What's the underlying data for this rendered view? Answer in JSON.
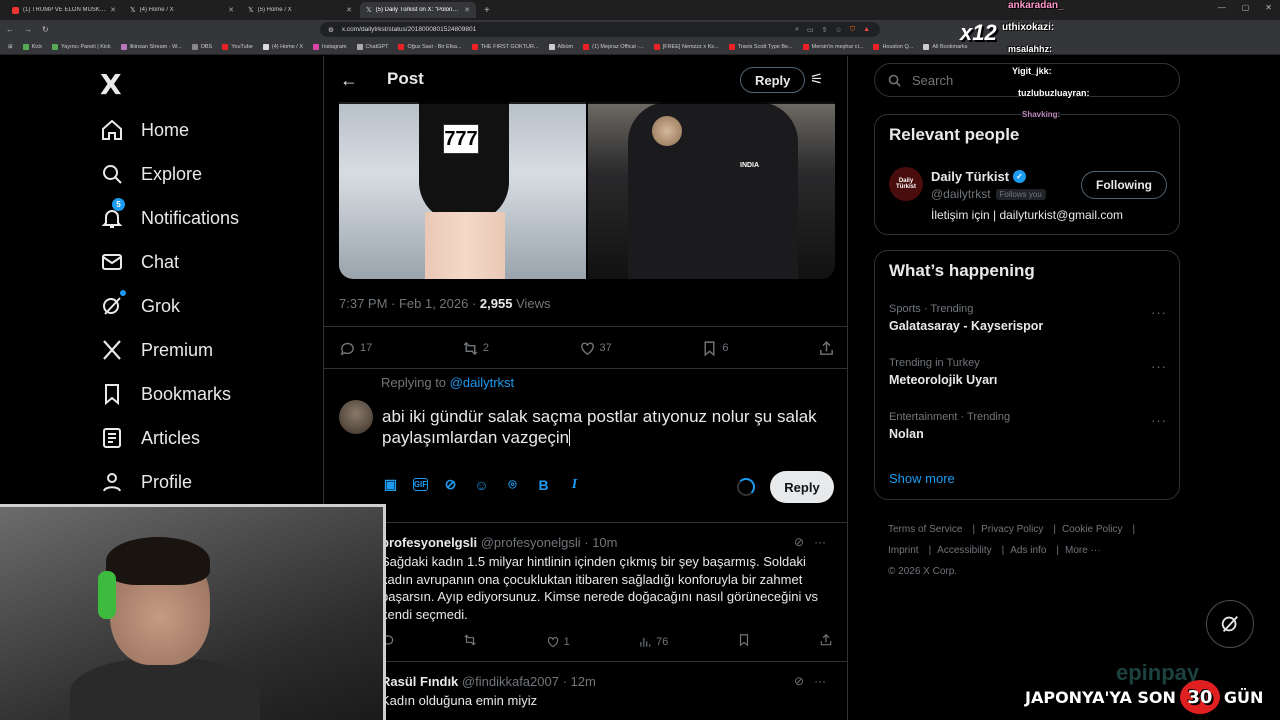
{
  "browser": {
    "tabs": [
      {
        "title": "(1) TRUMP VE ELON MUSK İFŞA OLD",
        "active": false
      },
      {
        "title": "(4) Home / X",
        "active": false
      },
      {
        "title": "(5) Home / X",
        "active": false
      },
      {
        "title": "(5) Daily Türkist on X: \"Polonya'lı",
        "active": true
      }
    ],
    "url": "x.com/dailytrkst/status/2018000801524809801",
    "bookmarks": [
      "Kick",
      "Yayıncı Paneli | Kick",
      "ilkinsan Stream - W...",
      "OBS",
      "YouTube",
      "(4) Home / X",
      "Instagram",
      "ChatGPT",
      "Oğuz Sasi - Bir Efsa...",
      "THE FIRST GOKTUR...",
      "Albüm",
      "(1) Mepraz Offical -...",
      "[FREE] Nemzzz x Ks...",
      "Travis Scott Type Be...",
      "Mersin'in meşhur ci...",
      "Houston Q...",
      "All Bookmarks"
    ]
  },
  "nav": {
    "logo": "X",
    "items": [
      {
        "label": "Home",
        "icon": "home-icon"
      },
      {
        "label": "Explore",
        "icon": "search-icon"
      },
      {
        "label": "Notifications",
        "icon": "bell-icon",
        "badge": "5"
      },
      {
        "label": "Chat",
        "icon": "mail-icon"
      },
      {
        "label": "Grok",
        "icon": "grok-icon"
      },
      {
        "label": "Premium",
        "icon": "x-premium-icon"
      },
      {
        "label": "Bookmarks",
        "icon": "bookmark-icon"
      },
      {
        "label": "Articles",
        "icon": "article-icon"
      },
      {
        "label": "Profile",
        "icon": "person-icon"
      }
    ]
  },
  "post": {
    "header_title": "Post",
    "header_reply": "Reply",
    "bib_number": "777",
    "right_image_text": "INDIA",
    "time": "7:37 PM · Feb 1, 2026 · ",
    "views_count": "2,955",
    "views_label": " Views",
    "actions": {
      "replies": "17",
      "reposts": "2",
      "likes": "37",
      "bookmarks": "6"
    }
  },
  "compose": {
    "replying_prefix": "Replying to ",
    "replying_handle": "@dailytrkst",
    "text": "abi iki gündür salak saçma postlar atıyonuz nolur şu salak paylaşımlardan vazgeçin",
    "reply_button": "Reply"
  },
  "replies": [
    {
      "name": "profesyonelgsli",
      "handle": "@profesyonelgsli",
      "time": "· 10m",
      "text": "Sağdaki kadın 1.5 milyar hintlinin içinden çıkmış bir şey başarmış. Soldaki kadın avrupanın ona çocukluktan itibaren sağladığı konforuyla bir zahmet başarsın. Ayıp ediyorsunuz. Kimse nerede doğacağını nasıl görüneceğini vs kendi seçmedi.",
      "likes": "1",
      "views": "76"
    },
    {
      "name": "Rasül Fındık",
      "handle": "@findikkafa2007",
      "time": "· 12m",
      "text": "Kadın olduğuna emin miyiz"
    }
  ],
  "sidebar": {
    "search_placeholder": "Search",
    "relevant_title": "Relevant people",
    "person": {
      "avatar_text": "Daily Türkist",
      "name": "Daily Türkist",
      "handle": "@dailytrkst",
      "follows_you": "Follows you",
      "bio": "İletişim için | dailyturkist@gmail.com",
      "button": "Following"
    },
    "happening_title": "What’s happening",
    "trends": [
      {
        "category": "Sports · Trending",
        "name": "Galatasaray - Kayserispor"
      },
      {
        "category": "Trending in Turkey",
        "name": "Meteorolojik Uyarı"
      },
      {
        "category": "Entertainment · Trending",
        "name": "Nolan"
      }
    ],
    "show_more": "Show more",
    "footer": [
      "Terms of Service",
      "Privacy Policy",
      "Cookie Policy",
      "Imprint",
      "Accessibility",
      "Ads info",
      "More ···"
    ],
    "copyright": "© 2026 X Corp."
  },
  "overlay": {
    "chat_lines": [
      "ankaradan_",
      "uthixokazi:",
      "msalahhz:",
      "Yigit_jkk:",
      "tuzlubuzluayran:",
      "Shavking:"
    ],
    "multiplier": "x12",
    "countdown_prefix": "JAPONYA'YA SON",
    "countdown_number": "30",
    "countdown_suffix": "GÜN",
    "watermark": "epinpay"
  },
  "colors": {
    "accent": "#1d9bf0",
    "background": "#000000",
    "border": "#2f3336",
    "muted": "#71767b"
  }
}
